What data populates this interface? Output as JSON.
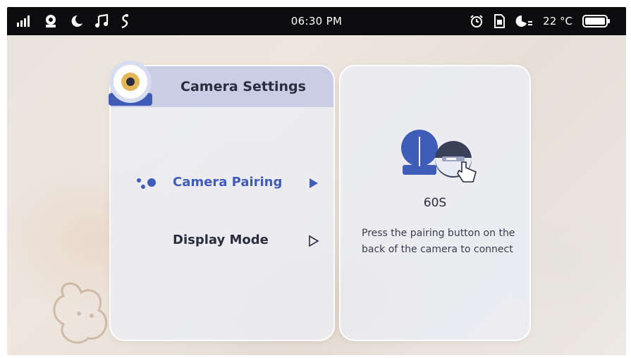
{
  "status_bar": {
    "time": "06:30 PM",
    "temperature": "22 °C",
    "left_icons": [
      "signal-icon",
      "camera-icon",
      "moon-icon",
      "music-icon",
      "lullaby-icon"
    ],
    "right_icons": [
      "alarm-icon",
      "sd-card-icon",
      "feeding-icon",
      "battery-icon"
    ],
    "battery_level": 1.0
  },
  "settings_panel": {
    "title": "Camera Settings",
    "items": [
      {
        "label": "Camera Pairing",
        "selected": true
      },
      {
        "label": "Display Mode",
        "selected": false
      }
    ]
  },
  "pairing_panel": {
    "countdown": "60S",
    "instruction": "Press the pairing button on the back of the camera to connect"
  },
  "colors": {
    "accent": "#3e5cb8",
    "header": "#c9cde6",
    "status_bar": "#0c0c0f"
  }
}
